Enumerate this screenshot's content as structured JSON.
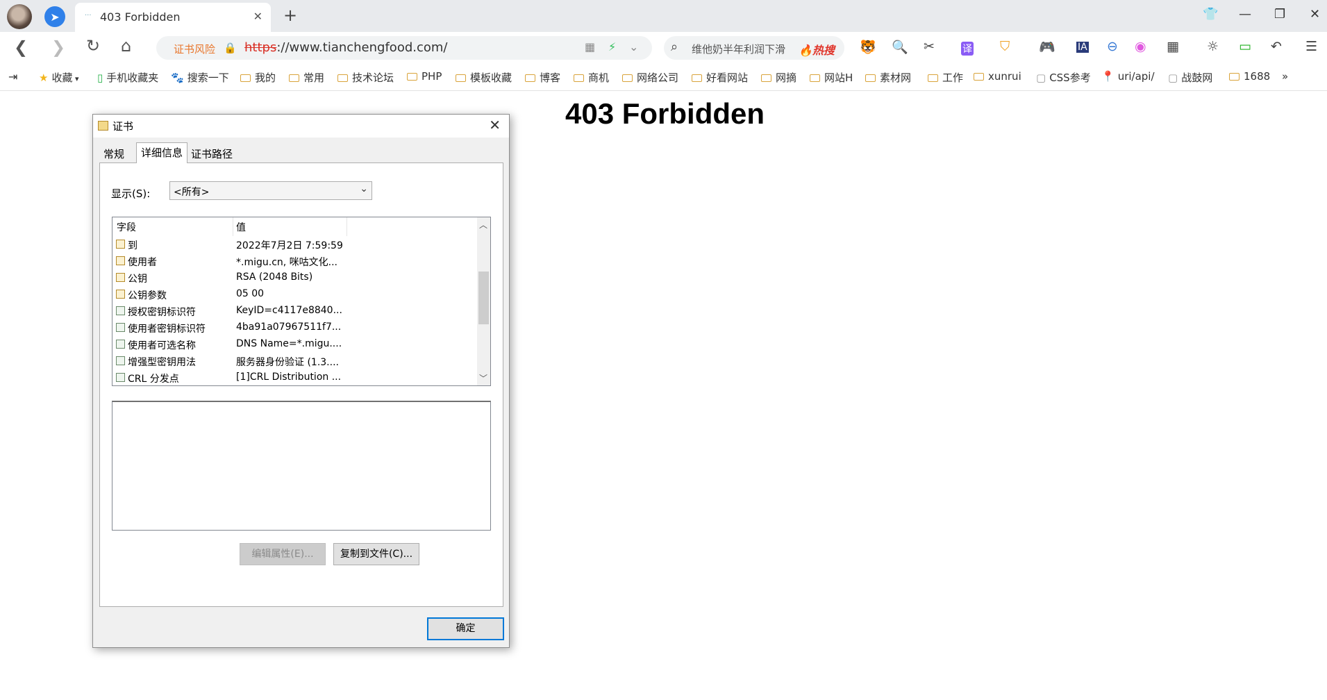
{
  "browser": {
    "tab_title": "403 Forbidden",
    "tab_favicon": "···",
    "url_scheme": "https",
    "url_rest": "://www.tianchengfood.com/",
    "cert_risk_label": "证书风险",
    "search_placeholder": "维他奶半年利润下滑",
    "search_hot_label": "热搜"
  },
  "bookmarks": [
    {
      "label": "收藏",
      "icon": "star-icon"
    },
    {
      "label": "手机收藏夹",
      "icon": "phone-icon"
    },
    {
      "label": "搜索一下",
      "icon": "baidu-paw-icon"
    },
    {
      "label": "我的",
      "icon": "folder-icon"
    },
    {
      "label": "常用",
      "icon": "folder-icon"
    },
    {
      "label": "技术论坛",
      "icon": "folder-icon"
    },
    {
      "label": "PHP",
      "icon": "folder-icon"
    },
    {
      "label": "模板收藏",
      "icon": "folder-icon"
    },
    {
      "label": "博客",
      "icon": "folder-icon"
    },
    {
      "label": "商机",
      "icon": "folder-icon"
    },
    {
      "label": "网络公司",
      "icon": "folder-icon"
    },
    {
      "label": "好看网站",
      "icon": "folder-icon"
    },
    {
      "label": "网摘",
      "icon": "folder-icon"
    },
    {
      "label": "网站H",
      "icon": "folder-icon"
    },
    {
      "label": "素材网",
      "icon": "folder-icon"
    },
    {
      "label": "工作",
      "icon": "folder-icon"
    },
    {
      "label": "xunrui",
      "icon": "folder-icon"
    },
    {
      "label": "CSS参考",
      "icon": "page-icon"
    },
    {
      "label": "uri/api/",
      "icon": "pin-icon"
    },
    {
      "label": "战鼓网",
      "icon": "page-icon"
    },
    {
      "label": "1688",
      "icon": "folder-icon"
    }
  ],
  "page": {
    "heading": "403 Forbidden"
  },
  "dialog": {
    "title": "证书",
    "tabs": [
      "常规",
      "详细信息",
      "证书路径"
    ],
    "active_tab": "详细信息",
    "show_label": "显示(S):",
    "show_value": "<所有>",
    "columns": {
      "field": "字段",
      "value": "值"
    },
    "rows": [
      {
        "field": "到",
        "value": "2022年7月2日 7:59:59",
        "icon": "cert-field-icon"
      },
      {
        "field": "使用者",
        "value": "*.migu.cn, 咪咕文化...",
        "icon": "cert-field-icon"
      },
      {
        "field": "公钥",
        "value": "RSA (2048 Bits)",
        "icon": "cert-field-icon"
      },
      {
        "field": "公钥参数",
        "value": "05 00",
        "icon": "cert-field-icon"
      },
      {
        "field": "授权密钥标识符",
        "value": "KeyID=c4117e8840...",
        "icon": "extension-icon"
      },
      {
        "field": "使用者密钥标识符",
        "value": "4ba91a07967511f7...",
        "icon": "extension-icon"
      },
      {
        "field": "使用者可选名称",
        "value": "DNS Name=*.migu....",
        "icon": "extension-icon"
      },
      {
        "field": "增强型密钥用法",
        "value": "服务器身份验证 (1.3....",
        "icon": "extension-icon"
      },
      {
        "field": "CRL 分发点",
        "value": "[1]CRL Distribution ...",
        "icon": "extension-icon"
      }
    ],
    "edit_properties_button": "编辑属性(E)...",
    "copy_to_file_button": "复制到文件(C)...",
    "ok_button": "确定"
  },
  "colors": {
    "accent": "#0078d7",
    "cert_risk": "#e8762c",
    "url_scheme_red": "#d93025"
  }
}
